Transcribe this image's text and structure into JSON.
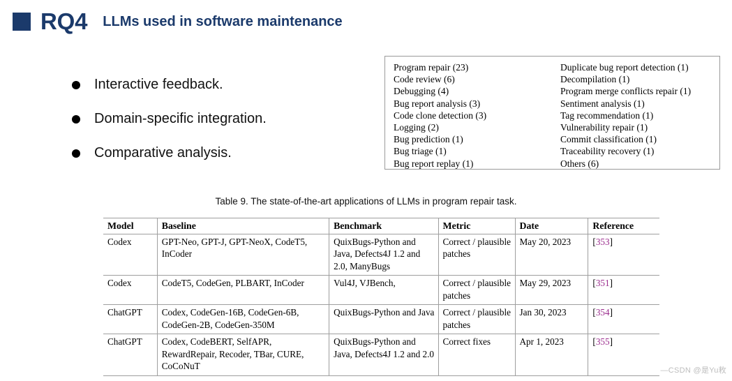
{
  "header": {
    "square_color": "#1b3a6b",
    "rq_label": "RQ4",
    "subtitle": "LLMs used in software maintenance"
  },
  "bullets": [
    {
      "text": "Interactive feedback."
    },
    {
      "text": "Domain-specific integration."
    },
    {
      "text": "Comparative analysis."
    }
  ],
  "task_box": {
    "left_column": [
      "Program repair (23)",
      "Code review (6)",
      "Debugging (4)",
      "Bug report analysis (3)",
      "Code clone detection (3)",
      "Logging (2)",
      "Bug prediction (1)",
      "Bug triage (1)",
      "Bug report replay (1)"
    ],
    "right_column": [
      "Duplicate bug report detection (1)",
      "Decompilation (1)",
      "Program merge conflicts repair (1)",
      "Sentiment analysis (1)",
      "Tag recommendation (1)",
      "Vulnerability repair (1)",
      "Commit classification (1)",
      "Traceability recovery (1)",
      "Others (6)"
    ]
  },
  "table": {
    "caption": "Table 9. The state-of-the-art applications of LLMs in program repair task.",
    "columns": [
      "Model",
      "Baseline",
      "Benchmark",
      "Metric",
      "Date",
      "Reference"
    ],
    "rows": [
      {
        "model": "Codex",
        "baseline": "GPT-Neo, GPT-J, GPT-NeoX, CodeT5, InCoder",
        "benchmark": "QuixBugs-Python and Java, Defects4J 1.2 and 2.0, ManyBugs",
        "metric": "Correct / plausible patches",
        "date": "May 20, 2023",
        "reference_open": "[",
        "reference_num": "353",
        "reference_close": "]"
      },
      {
        "model": "Codex",
        "baseline": "CodeT5, CodeGen, PLBART, InCoder",
        "benchmark": "Vul4J, VJBench,",
        "metric": "Correct / plausible patches",
        "date": "May 29, 2023",
        "reference_open": "[",
        "reference_num": "351",
        "reference_close": "]"
      },
      {
        "model": "ChatGPT",
        "baseline": "Codex, CodeGen-16B, CodeGen-6B, CodeGen-2B, CodeGen-350M",
        "benchmark": "QuixBugs-Python and Java",
        "metric": "Correct / plausible patches",
        "date": "Jan 30, 2023",
        "reference_open": "[",
        "reference_num": "354",
        "reference_close": "]"
      },
      {
        "model": "ChatGPT",
        "baseline": "Codex, CodeBERT, SelfAPR, RewardRepair, Recoder, TBar, CURE, CoCoNuT",
        "benchmark": "QuixBugs-Python and Java, Defects4J 1.2 and 2.0",
        "metric": "Correct fixes",
        "date": "Apr 1, 2023",
        "reference_open": "[",
        "reference_num": "355",
        "reference_close": "]"
      }
    ]
  },
  "watermark": {
    "text": "—CSDN @是Yu敉"
  }
}
